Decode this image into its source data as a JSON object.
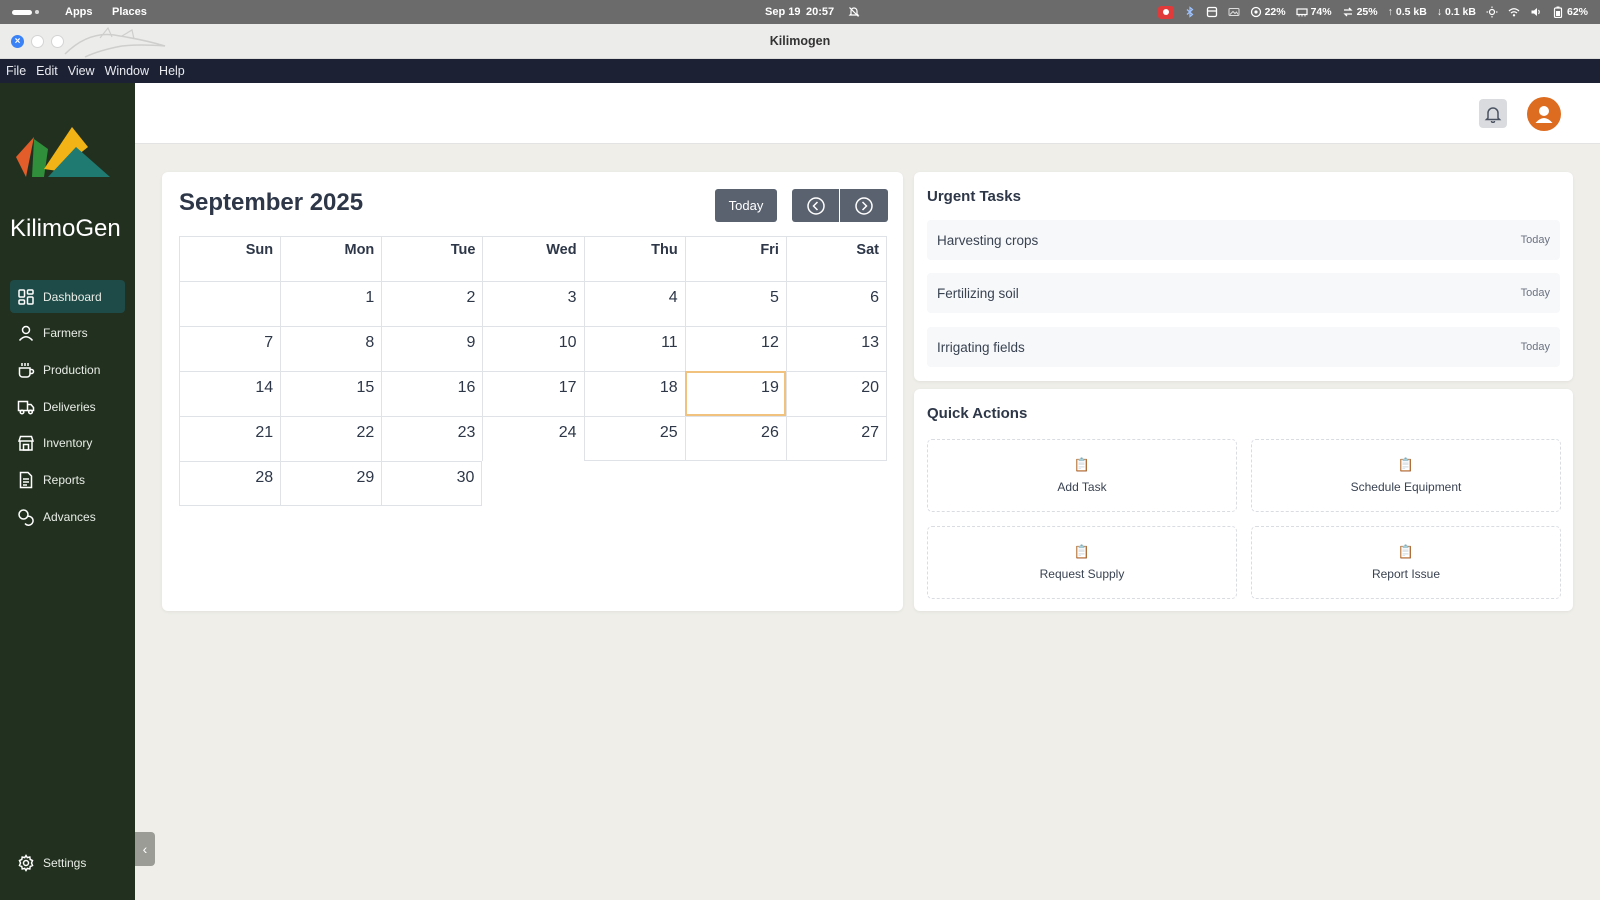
{
  "system_bar": {
    "apps": "Apps",
    "places": "Places",
    "date": "Sep 19",
    "time": "20:57",
    "cpu": "22%",
    "memory": "74%",
    "swap": "25%",
    "upload": "0.5 kB",
    "download": "0.1 kB",
    "battery": "62%"
  },
  "window": {
    "title": "Kilimogen"
  },
  "menubar": {
    "file": "File",
    "edit": "Edit",
    "view": "View",
    "window": "Window",
    "help": "Help"
  },
  "sidebar": {
    "brand": "KilimoGen",
    "items": [
      {
        "label": "Dashboard",
        "icon": "dashboard-icon"
      },
      {
        "label": "Farmers",
        "icon": "user-icon"
      },
      {
        "label": "Production",
        "icon": "cup-icon"
      },
      {
        "label": "Deliveries",
        "icon": "truck-icon"
      },
      {
        "label": "Inventory",
        "icon": "store-icon"
      },
      {
        "label": "Reports",
        "icon": "document-icon"
      },
      {
        "label": "Advances",
        "icon": "coins-icon"
      }
    ],
    "settings": "Settings"
  },
  "calendar": {
    "title": "September 2025",
    "today_label": "Today",
    "weekdays": [
      "Sun",
      "Mon",
      "Tue",
      "Wed",
      "Thu",
      "Fri",
      "Sat"
    ],
    "weeks": [
      [
        "",
        "1",
        "2",
        "3",
        "4",
        "5",
        "6"
      ],
      [
        "7",
        "8",
        "9",
        "10",
        "11",
        "12",
        "13"
      ],
      [
        "14",
        "15",
        "16",
        "17",
        "18",
        "19",
        "20"
      ],
      [
        "21",
        "22",
        "23",
        "24",
        "25",
        "26",
        "27"
      ],
      [
        "28",
        "29",
        "30",
        "",
        "",
        "",
        ""
      ]
    ],
    "selected_day": "19"
  },
  "urgent_tasks": {
    "title": "Urgent Tasks",
    "items": [
      {
        "name": "Harvesting crops",
        "due": "Today"
      },
      {
        "name": "Fertilizing soil",
        "due": "Today"
      },
      {
        "name": "Irrigating fields",
        "due": "Today"
      }
    ]
  },
  "quick_actions": {
    "title": "Quick Actions",
    "icon": "📋",
    "items": [
      {
        "label": "Add Task"
      },
      {
        "label": "Schedule Equipment"
      },
      {
        "label": "Request Supply"
      },
      {
        "label": "Report Issue"
      }
    ]
  },
  "colors": {
    "sidebar_bg": "#22311f",
    "active_nav": "#1e4a47",
    "accent_orange": "#dd6b20",
    "button_gray": "#5a6270",
    "selected_day_outline": "#f1c27d"
  }
}
